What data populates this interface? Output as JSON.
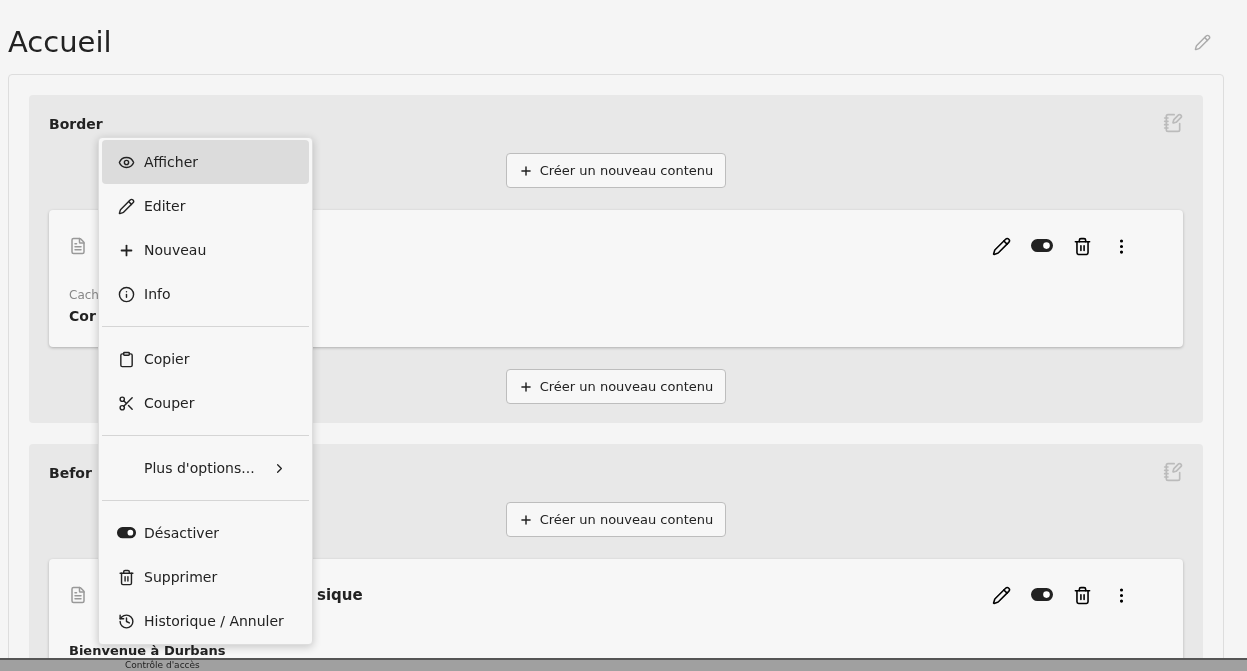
{
  "page": {
    "title": "Accueil"
  },
  "sections": [
    {
      "heading": "Border",
      "create_buttons": [
        "Créer un nouveau contenu",
        "Créer un nouveau contenu"
      ],
      "card": {
        "label": "Cach",
        "text": "Cor",
        "enabled": true
      }
    },
    {
      "heading": "Befor",
      "create_buttons": [
        "Créer un nouveau contenu"
      ],
      "card": {
        "title": "sique",
        "text": "Bienvenue à Durbans",
        "enabled": true
      }
    }
  ],
  "context_menu": {
    "items": [
      {
        "kind": "item",
        "label": "Afficher",
        "selected": true
      },
      {
        "kind": "item",
        "label": "Editer",
        "selected": false
      },
      {
        "kind": "item",
        "label": "Nouveau",
        "selected": false
      },
      {
        "kind": "item",
        "label": "Info",
        "selected": false
      },
      {
        "kind": "divider"
      },
      {
        "kind": "item",
        "label": "Copier",
        "selected": false
      },
      {
        "kind": "item",
        "label": "Couper",
        "selected": false
      },
      {
        "kind": "divider"
      },
      {
        "kind": "submenu",
        "label": "Plus d'options...",
        "selected": false
      },
      {
        "kind": "divider"
      },
      {
        "kind": "item",
        "label": "Désactiver",
        "selected": false
      },
      {
        "kind": "item",
        "label": "Supprimer",
        "selected": false
      },
      {
        "kind": "item",
        "label": "Historique / Annuler",
        "selected": false
      }
    ]
  },
  "bottom_bar": {
    "label": "Contrôle d'accès"
  }
}
